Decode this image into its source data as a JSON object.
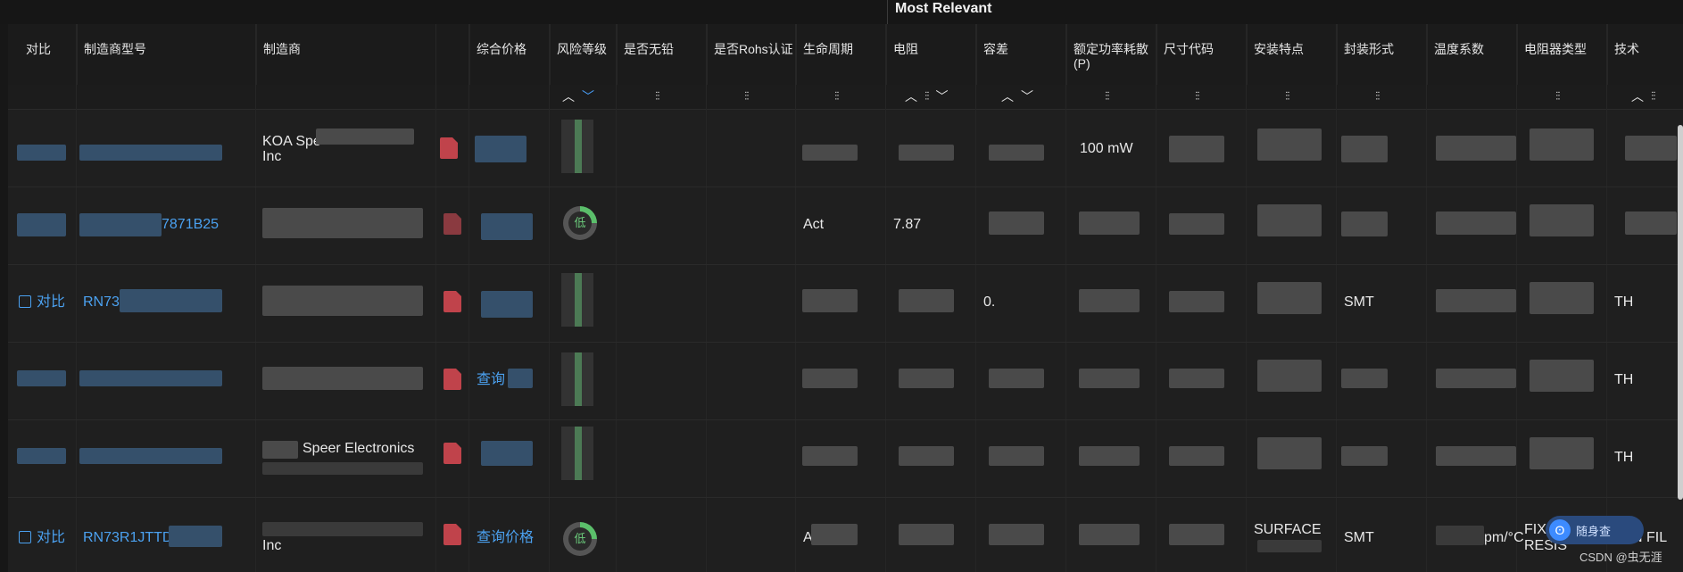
{
  "top_label": "Most Relevant",
  "headers": {
    "compare": "对比",
    "model": "制造商型号",
    "maker": "制造商",
    "price": "综合价格",
    "risk": "风险等级",
    "lead_free": "是否无铅",
    "rohs": "是否Rohs认证",
    "lifecycle": "生命周期",
    "resistance": "电阻",
    "tolerance": "容差",
    "power": "额定功率耗散 (P)",
    "size": "尺寸代码",
    "mount": "安装特点",
    "package": "封装形式",
    "temp": "温度系数",
    "res_type": "电阻器类型",
    "tech": "技术"
  },
  "icons": {
    "sort_up": "up-chevron-icon",
    "sort_down": "down-chevron-icon",
    "filter": "filter-icon",
    "pdf": "pdf-icon",
    "badge": "suishencha-logo-icon"
  },
  "rows": [
    {
      "maker": "KOA Spe",
      "maker2": "Inc",
      "power": "100 mW"
    },
    {
      "model": "7871B25",
      "lifecycle": "Act",
      "resistance": "7.87",
      "gauge_label": "低"
    },
    {
      "compare": "对比",
      "model": "RN73R",
      "tolerance": "0.",
      "package": "SMT",
      "tech": "TH"
    },
    {
      "price": "查询",
      "tech": "TH"
    },
    {
      "maker": "Speer Electronics",
      "tech": "TH"
    },
    {
      "compare": "对比",
      "model": "RN73R1JTTD",
      "maker": "Inc",
      "price": "查询价格",
      "gauge_label": "低",
      "lifecycle": "A",
      "mount": "SURFACE",
      "package": "SMT",
      "temp": "pm/°C",
      "res_type": "FIX",
      "res_type2": "RESIS",
      "tech": "N FIL"
    }
  ],
  "watermark": {
    "text": "随身查",
    "credit": "CSDN @虫无涯"
  }
}
